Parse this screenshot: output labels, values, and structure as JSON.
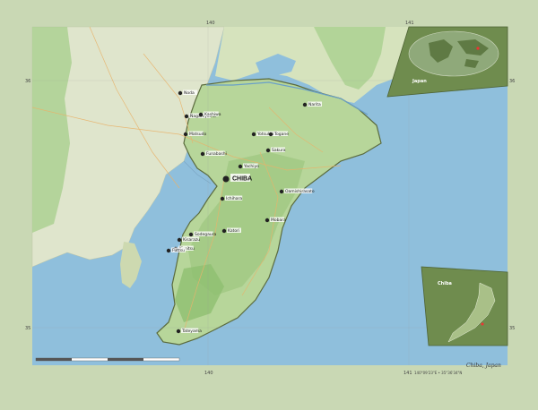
{
  "map": {
    "region_name": "Chiba",
    "region_big_label": "CHIBA",
    "country": "Japan",
    "caption": "Chiba, Japan",
    "coordinates_text": "140°09'23\"E  •  35°36'34\"N",
    "colors": {
      "frame": "#c9d8b4",
      "sea": "#8fbfdc",
      "land_west": "#dfe5cc",
      "land_green": "#a9cf8e",
      "region_outline": "#5b6b3e"
    }
  },
  "graticule": {
    "top": [
      "140",
      "141"
    ],
    "bottom": [
      "140",
      "141"
    ],
    "left": [
      "36",
      "35"
    ],
    "right": [
      "36",
      "35"
    ]
  },
  "cities": [
    {
      "name": "Noda"
    },
    {
      "name": "Nagareyama"
    },
    {
      "name": "Kashiwa"
    },
    {
      "name": "Matsudo"
    },
    {
      "name": "Narita"
    },
    {
      "name": "Funabashi"
    },
    {
      "name": "Yachiyo"
    },
    {
      "name": "Sakura"
    },
    {
      "name": "Yotsukaido"
    },
    {
      "name": "Togane"
    },
    {
      "name": "Oamishirasato"
    },
    {
      "name": "Ichihara"
    },
    {
      "name": "Mobara"
    },
    {
      "name": "Sodegaura"
    },
    {
      "name": "Kisarazu"
    },
    {
      "name": "Kimitsu"
    },
    {
      "name": "Futtsu"
    },
    {
      "name": "Tateyama"
    },
    {
      "name": "Katori"
    }
  ],
  "insets": {
    "world_label": "Japan",
    "country_label": "Chiba"
  }
}
